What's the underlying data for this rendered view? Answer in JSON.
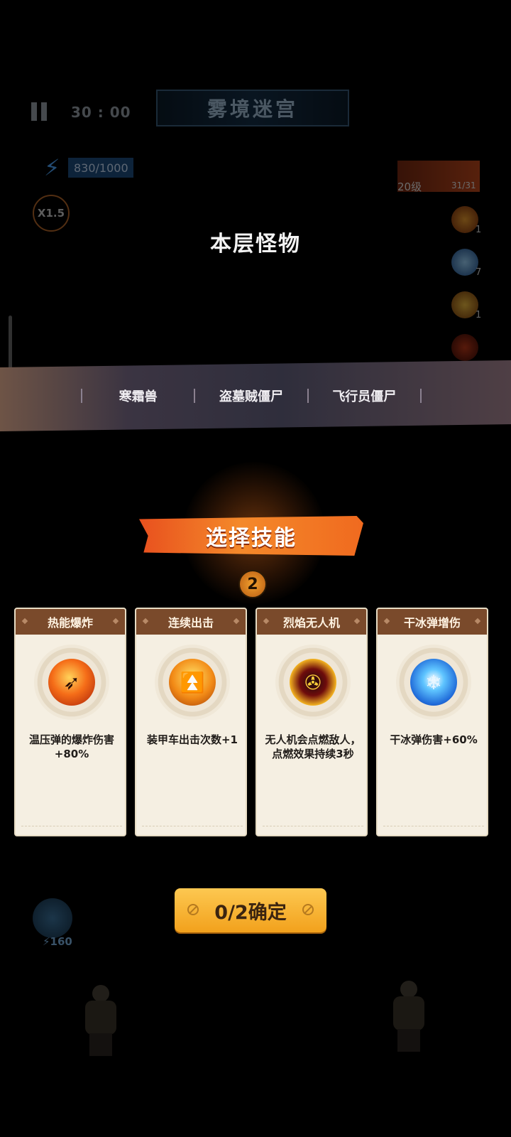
{
  "hud": {
    "timer": "30 : 00",
    "level_title": "雾境迷宫",
    "energy": "830/1000",
    "speed": "X1.5",
    "weapon_level": "20级",
    "weapon_ammo": "31/31",
    "skill_slots": [
      {
        "icon": "fire-bullet-icon",
        "count": "1"
      },
      {
        "icon": "ice-shard-icon",
        "count": "7"
      },
      {
        "icon": "armor-icon",
        "count": "1"
      },
      {
        "icon": "drone-icon",
        "count": ""
      }
    ],
    "tower_cost": "160"
  },
  "overlay": {
    "floor_title": "本层怪物",
    "monsters": [
      "寒霜兽",
      "盗墓贼僵尸",
      "飞行员僵尸"
    ],
    "select_title": "选择技能",
    "pick_count": "2",
    "confirm_label": "0/2确定"
  },
  "cards": [
    {
      "title": "热能爆炸",
      "icon": "incendiary-shell-icon",
      "desc": "温压弹的爆炸伤害+80%"
    },
    {
      "title": "连续出击",
      "icon": "armored-car-icon",
      "desc": "装甲车出击次数+1"
    },
    {
      "title": "烈焰无人机",
      "icon": "flame-drone-icon",
      "desc": "无人机会点燃敌人，点燃效果持续3秒"
    },
    {
      "title": "干冰弹增伤",
      "icon": "dry-ice-bullet-icon",
      "desc": "干冰弹伤害+60%"
    }
  ],
  "colors": {
    "accent": "#f4892a",
    "card_header": "#7a4a2b",
    "button": "#f2a11c"
  }
}
